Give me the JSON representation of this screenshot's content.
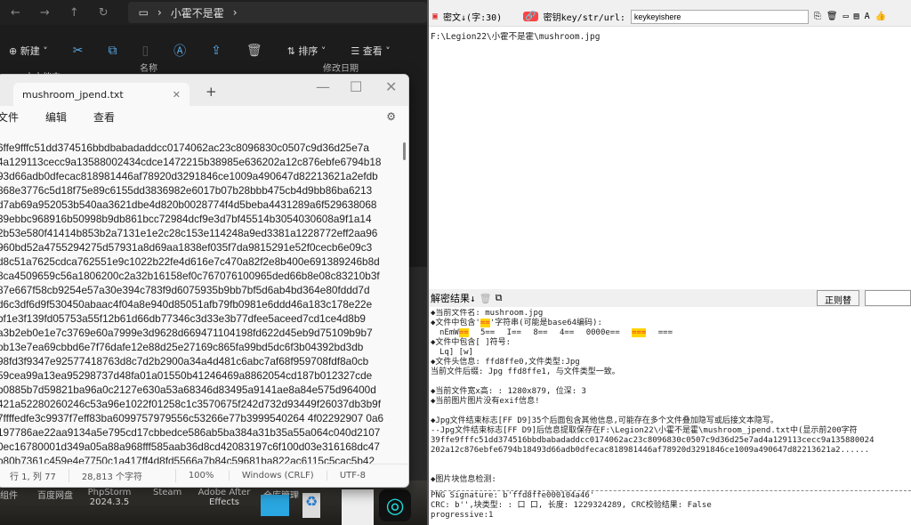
{
  "explorer": {
    "breadcrumb": "小霍不是霍",
    "toolbar": {
      "new": "新建",
      "sort": "排序",
      "view": "查看"
    },
    "columns": {
      "name": "名称",
      "modified": "修改日期"
    },
    "sidebar_item": "本文档夹"
  },
  "notepad": {
    "tab_title": "mushroom_jpend.txt",
    "menu": [
      "文件",
      "编辑",
      "查看"
    ],
    "lines": [
      "6ffe9fffc51dd374516bbdbabadaddcc0174062ac23c8096830c0507c9d36d25e7a",
      "4a129113cecc9a13588002434cdce1472215b38985e636202a12c876ebfe6794b18",
      "93d66adb0dfecac818981446af78920d3291846ce1009a490647d82213621a2efdb",
      "868e3776c5d18f75e89c6155dd3836982e6017b07b28bbb475cb4d9bb86ba6213",
      "d7ab69a952053b540aa3621dbe4d820b0028774f4d5beba4431289a6f529638068",
      "39ebbc968916b50998b9db861bcc72984dcf9e3d7bf45514b3054030608a9f1a14",
      "2b53e580f41414b853b2a7131e1e2c28c153e114248a9ed3381a1228772eff2aa96",
      "960bd52a4755294275d57931a8d69aa1838ef035f7da9815291e52f0cecb6e09c3",
      "d8c51a7625cdca762551e9c1022b22fe4d616e7c470a82f2e8b400e691389246b8d",
      "8ca4509659c56a1806200c2a32b16158ef0c767076100965ded66b8e08c83210b3f",
      "87e667f58cb9254e57a30e394c783f9d6075935b9bb7bf5d6ab4bd364e80fddd7d",
      "d6c3df6d9f530450abaac4f04a8e940d85051afb79fb0981e6ddd46a183c178e22e",
      "bf1e3f139fd05753a55f12b61d66db77346c3d33e3b77dfee5aceed7cd1ce4d8b9",
      "a3b2eb0e1e7c3769e60a7999e3d9628d669471104198fd622d45eb9d75109b9b7",
      "ob13e7ea69cbbd6e7f76dafe12e88d25e27169c865fa99bd5dc6f3b04392bd3db",
      "98fd3f9347e92577418763d8c7d2b2900a34a4d481c6abc7af68f959708fdf8a0cb",
      "59cea99a13ea95298737d48fa01a01550b41246469a8862054cd187b012327cde",
      "b0885b7d59821ba96a0c2127e630a53a68346d83495a9141ae8a84e575d96400d",
      "421a52280260246c53a96e1022f01258c1c3570675f242d732d93449f26037db3b9f",
      "7ffffedfe3c9937f7eff83ba6099757979556c53266e77b3999540264 4f02292907 0a6",
      "197786ae22aa9134a5e795cd17cbbedce586ab5ba384a31b35a55a064c040d2107",
      "0ec16780001d349a05a88a968fff585aab36d8cd42083197c6f100d03e316168dc47",
      "b80b7361c459e4e7750c1a417ff4d8fd5566a7b84c59681ba822ac6115c5cac5b42"
    ],
    "status": {
      "position": "行 1, 列 77",
      "chars": "28,813 个字符",
      "zoom": "100%",
      "eol": "Windows (CRLF)",
      "encoding": "UTF-8"
    }
  },
  "desktop": {
    "icons": [
      "组件",
      "百度网盘",
      "PhpStorm 2024.3.5",
      "Steam",
      "Adobe After Effects",
      "仓库管理"
    ]
  },
  "tool": {
    "cipher_label": "密文↓(字:30)",
    "key_label": "密钥key/str/url:",
    "key_value": "keykeyishere",
    "path": "F:\\Legion22\\小霍不是霍\\mushroom.jpg",
    "result_label": "解密结果↓",
    "regex_button": "正则替",
    "results": {
      "filename": "◆当前文件名: mushroom.jpg",
      "contains_eq_a": "◆文件中包含'",
      "contains_eq_hl": "==",
      "contains_eq_b": "'字符串(可能是base64编码):",
      "eq_items": [
        "nEmW",
        "==",
        "5==",
        "I==",
        "8==",
        "4==",
        "0000e==",
        "===",
        "==="
      ],
      "brackets": "◆文件中包含[ ]符号:",
      "brackets_val": "Lq] [w]",
      "header": "◆文件头信息: ffd8ffe0,文件类型:Jpg",
      "ext": "当前文件后缀: Jpg  ffd8ffe1, 与文件类型一致。",
      "size": "◆当前文件宽x高: : 1280x879, 位深: 3",
      "exif": "◆当前图片图片没有exif信息!",
      "jpgend": "◆Jpg文件结束标志[FF D9]35个后面包含其他信息,可能存在多个文件叠加隐写或后接文本隐写。",
      "jpgsave": "--Jpg文件结束标志[FF D9]后信息提取保存在F:\\Legion22\\小霍不是霍\\mushroom_jpend.txt中(显示前200字符",
      "hex1": "39ffe9fffc51dd374516bbdbabadaddcc0174062ac23c8096830c0507c9d36d25e7ad4a129113cecc9a135880024",
      "hex2": "202a12c876ebfe6794b18493d66adb0dfecac818981446af78920d3291846ce1009a490647d82213621a2......",
      "block": "◆图片块信息检测:",
      "png": "PNG Signature: b'ffd8ffe000104a46'",
      "crc": "CRC: b'',块类型: : 口 口, 长度: 1229324289, CRC校验结果: False",
      "prog": "progressive:1"
    }
  }
}
